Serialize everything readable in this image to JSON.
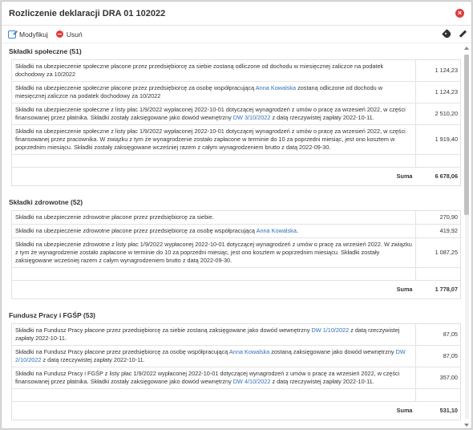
{
  "title": "Rozliczenie deklaracji DRA 01 102022",
  "toolbar": {
    "modify_label": "Modyfikuj",
    "delete_label": "Usuń"
  },
  "sum_label": "Suma",
  "sections": [
    {
      "title": "Składki społeczne (51)",
      "rows": [
        {
          "parts": [
            {
              "t": "Składki na ubezpieczenie społeczne płacone przez przedsiębiorcę za siebie zostaną odliczone od dochodu w miesięcznej zaliczce na podatek dochodowy za 10/2022"
            }
          ],
          "amount": "1 124,23"
        },
        {
          "parts": [
            {
              "t": "Składki na ubezpieczenie społeczne płacone przez przedsiębiorcę za osobę współpracującą "
            },
            {
              "t": "Anna Kowalska",
              "link": true
            },
            {
              "t": " zostaną odliczone od dochodu w miesięcznej zaliczce na podatek dochodowy za 10/2022"
            }
          ],
          "amount": "1 124,23"
        },
        {
          "parts": [
            {
              "t": "Składki na ubezpieczenie społeczne z listy płac 1/9/2022 wypłaconej 2022-10-01 dotyczącej wynagrodzeń z umów o pracę za wrzesień 2022, w części finansowanej przez płatnika. Składki zostały zaksięgowane jako dowód wewnętrzny "
            },
            {
              "t": "DW 3/10/2022",
              "link": true
            },
            {
              "t": " z datą rzeczywistej zapłaty 2022-10-11."
            }
          ],
          "amount": "2 510,20"
        },
        {
          "parts": [
            {
              "t": "Składki na ubezpieczenie społeczne z listy płac 1/9/2022 wypłaconej 2022-10-01 dotyczącej wynagrodzeń z umów o pracę za wrzesień 2022, w części finansowanej przez pracownika. W związku z tym że wynagrodzenie zostało zapłacone w terminie do 10 za poprzedni miesiąc, jest ono kosztem w poprzednim miesiącu. Składki zostały zaksięgowane wcześniej razem z całym wynagrodzeniem brutto z datą 2022-09-30."
            }
          ],
          "amount": "1 919,40"
        }
      ],
      "sum": "6 678,06"
    },
    {
      "title": "Składki zdrowotne (52)",
      "rows": [
        {
          "parts": [
            {
              "t": "Składki na ubezpieczenie zdrowotne płacone przez przedsiębiorcę za siebie."
            }
          ],
          "amount": "270,90"
        },
        {
          "parts": [
            {
              "t": "Składki na ubezpieczenie zdrowotne płacone przez przedsiębiorcę za osobę współpracującą "
            },
            {
              "t": "Anna Kowalska",
              "link": true
            },
            {
              "t": "."
            }
          ],
          "amount": "419,92"
        },
        {
          "parts": [
            {
              "t": "Składki na ubezpieczenie zdrowotne z listy płac 1/9/2022 wypłaconej 2022-10-01 dotyczącej wynagrodzeń z umów o pracę za wrzesień 2022. W związku z tym że wynagrodzenie zostało zapłacone w terminie do 10 za poprzedni miesiąc, jest ono kosztem w poprzednim miesiącu. Składki zostały zaksięgowane wcześniej razem z całym wynagrodzeniem brutto z datą 2022-09-30."
            }
          ],
          "amount": "1 087,25"
        }
      ],
      "sum": "1 778,07"
    },
    {
      "title": "Fundusz Pracy i FGŚP (53)",
      "rows": [
        {
          "parts": [
            {
              "t": "Składki na Fundusz Pracy płacone przez przedsiębiorcę za siebie zostaną zaksięgowane jako dowód wewnętrzny "
            },
            {
              "t": "DW 1/10/2022",
              "link": true
            },
            {
              "t": " z datą rzeczywistej zapłaty 2022-10-11."
            }
          ],
          "amount": "87,05"
        },
        {
          "parts": [
            {
              "t": "Składki na Fundusz Pracy płacone przez przedsiębiorcę za osobę współpracującą "
            },
            {
              "t": "Anna Kowalska",
              "link": true
            },
            {
              "t": " zostaną zaksięgowane jako dowód wewnętrzny "
            },
            {
              "t": "DW 2/10/2022",
              "link": true
            },
            {
              "t": " z datą rzeczywistej zapłaty 2022-10-11."
            }
          ],
          "amount": "87,05"
        },
        {
          "parts": [
            {
              "t": "Składki na Fundusz Pracy i FGŚP z listy płac 1/9/2022 wypłaconej 2022-10-01 dotyczącej wynagrodzeń z umów o pracę za wrzesień 2022, w części finansowanej przez płatnika. Składki zostały zaksięgowane jako dowód wewnętrzny "
            },
            {
              "t": "DW 4/10/2022",
              "link": true
            },
            {
              "t": " z datą rzeczywistej zapłaty 2022-10-11."
            }
          ],
          "amount": "357,00"
        }
      ],
      "sum": "531,10"
    }
  ]
}
